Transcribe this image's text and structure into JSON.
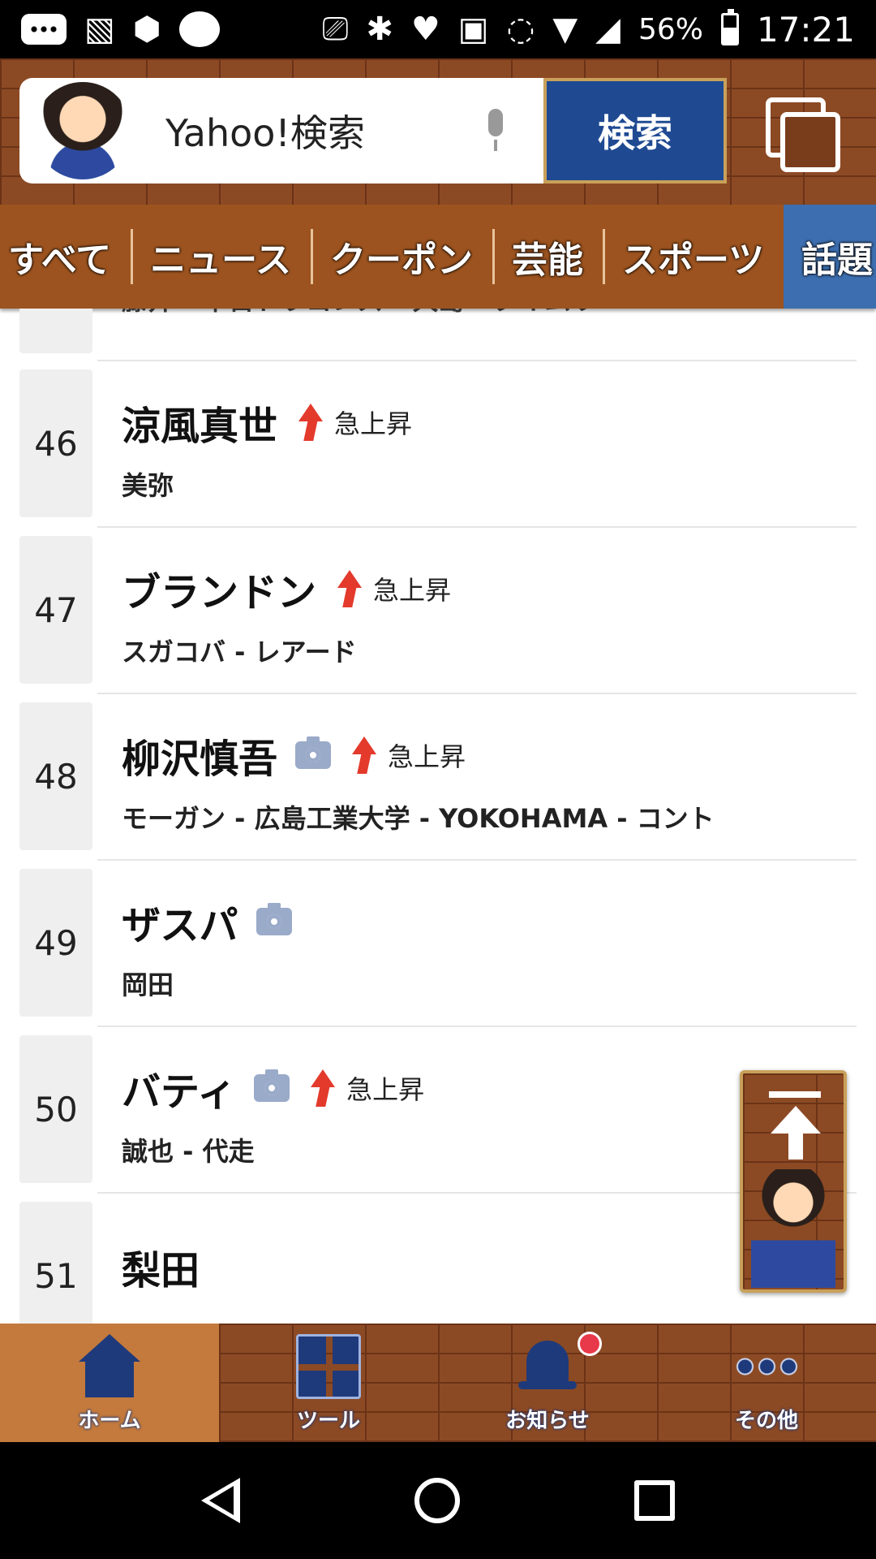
{
  "status_bar": {
    "battery_percent": "56%",
    "time": "17:21",
    "icons": [
      "chat-icon",
      "gallery-icon",
      "app-icon",
      "bubble-icon",
      "cast-icon",
      "bluetooth-icon",
      "heart-shield-icon",
      "vr-icon",
      "nfc-icon",
      "wifi-icon",
      "signal-icon",
      "battery-icon"
    ]
  },
  "header": {
    "search_placeholder": "Yahoo!検索",
    "search_button": "検索"
  },
  "categories": {
    "items": [
      {
        "label": "すべて"
      },
      {
        "label": "ニュース"
      },
      {
        "label": "クーポン"
      },
      {
        "label": "芸能"
      },
      {
        "label": "スポーツ"
      },
      {
        "label": "話題"
      }
    ],
    "active": "話題"
  },
  "ranking": {
    "partial_sub": "藤井 - 中日ドラゴンズ - 大島 - タイムリー",
    "rows": [
      {
        "rank": "46",
        "name": "涼風真世",
        "has_camera": false,
        "rise": "急上昇",
        "sub": "美弥"
      },
      {
        "rank": "47",
        "name": "ブランドン",
        "has_camera": false,
        "rise": "急上昇",
        "sub": "スガコバ - レアード"
      },
      {
        "rank": "48",
        "name": "柳沢慎吾",
        "has_camera": true,
        "rise": "急上昇",
        "sub": "モーガン - 広島工業大学 - YOKOHAMA - コント"
      },
      {
        "rank": "49",
        "name": "ザスパ",
        "has_camera": true,
        "rise": "",
        "sub": "岡田"
      },
      {
        "rank": "50",
        "name": "バティ",
        "has_camera": true,
        "rise": "急上昇",
        "sub": "誠也 - 代走"
      },
      {
        "rank": "51",
        "name": "梨田",
        "has_camera": false,
        "rise": "",
        "sub": ""
      }
    ]
  },
  "bottom_nav": {
    "items": [
      {
        "label": "ホーム",
        "icon": "home-icon",
        "active": true
      },
      {
        "label": "ツール",
        "icon": "grid-icon",
        "active": false
      },
      {
        "label": "お知らせ",
        "icon": "bell-icon",
        "active": false
      },
      {
        "label": "その他",
        "icon": "more-icon",
        "active": false
      }
    ]
  },
  "colors": {
    "brick": "#8c4a24",
    "category_bar": "#9c531f",
    "active_tab": "#3d6fb0",
    "search_button": "#1f4a92",
    "rise_red": "#e33a2c",
    "nav_blue": "#1f3a7a"
  }
}
